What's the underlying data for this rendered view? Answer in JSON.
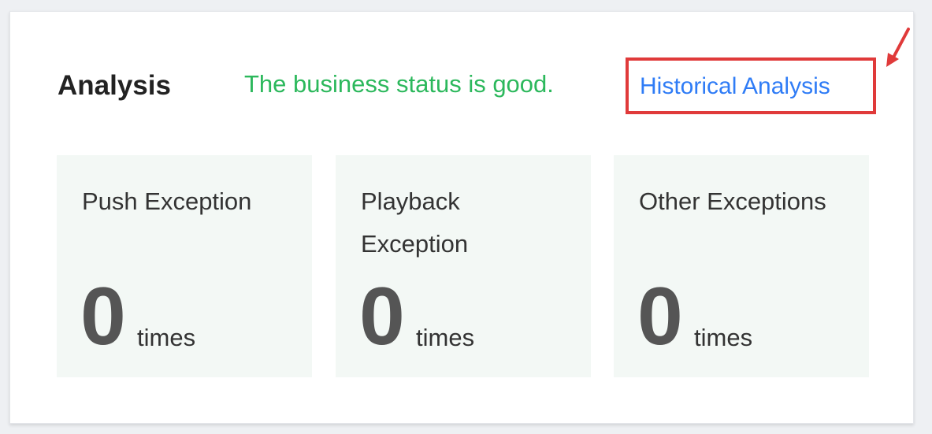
{
  "card": {
    "title": "Analysis",
    "status_text": "The business status is good.",
    "history_link": "Historical Analysis"
  },
  "tiles": [
    {
      "label": "Push Exception",
      "count": "0",
      "unit": "times"
    },
    {
      "label": "Playback Exception",
      "count": "0",
      "unit": "times"
    },
    {
      "label": "Other Exceptions",
      "count": "0",
      "unit": "times"
    }
  ],
  "colors": {
    "status": "#2cb85c",
    "link": "#2f7cf6",
    "highlight": "#e03a3a",
    "tile_bg": "#f3f8f5"
  }
}
